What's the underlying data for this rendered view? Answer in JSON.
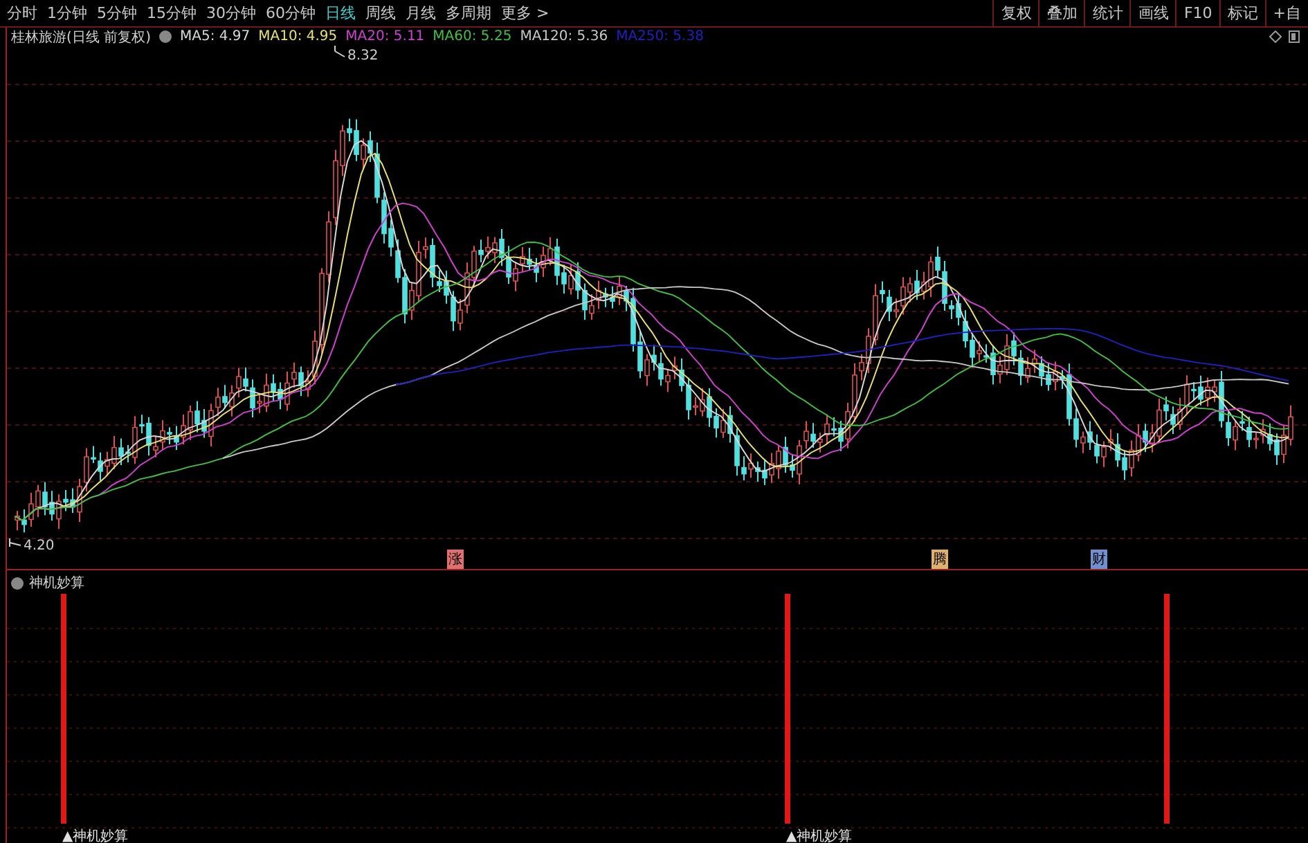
{
  "toolbar": {
    "periods": [
      {
        "label": "分时",
        "selected": false
      },
      {
        "label": "1分钟",
        "selected": false
      },
      {
        "label": "5分钟",
        "selected": false
      },
      {
        "label": "15分钟",
        "selected": false
      },
      {
        "label": "30分钟",
        "selected": false
      },
      {
        "label": "60分钟",
        "selected": false
      },
      {
        "label": "日线",
        "selected": true
      },
      {
        "label": "周线",
        "selected": false
      },
      {
        "label": "月线",
        "selected": false
      },
      {
        "label": "多周期",
        "selected": false
      },
      {
        "label": "更多 >",
        "selected": false
      }
    ],
    "actions": [
      "复权",
      "叠加",
      "统计",
      "画线",
      "F10",
      "标记",
      "+自"
    ]
  },
  "legend": {
    "title": "桂林旅游(日线 前复权)",
    "averages": [
      {
        "label": "MA5: 4.97",
        "color": "#d8d8d8"
      },
      {
        "label": "MA10: 4.95",
        "color": "#e8e070"
      },
      {
        "label": "MA20: 5.11",
        "color": "#d040d0"
      },
      {
        "label": "MA60: 5.25",
        "color": "#40c040"
      },
      {
        "label": "MA120: 5.36",
        "color": "#c8c8c8"
      },
      {
        "label": "MA250: 5.38",
        "color": "#2020c0"
      }
    ]
  },
  "main_chart": {
    "high_label": "8.32",
    "low_label": "4.20",
    "signals": [
      {
        "label": "涨",
        "color": "#e07070"
      },
      {
        "label": "腾",
        "color": "#e0b070"
      },
      {
        "label": "财",
        "color": "#7090d0"
      }
    ]
  },
  "indicator": {
    "title": "神机妙算",
    "signals": [
      "▲神机妙算",
      "▲神机妙算"
    ]
  }
}
